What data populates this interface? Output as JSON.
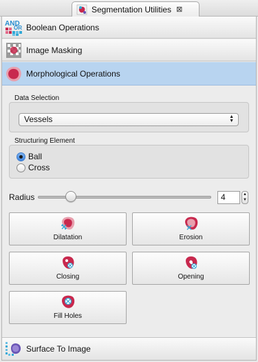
{
  "tab": {
    "title": "Segmentation Utilities",
    "close_icon": "close-icon",
    "icon": "segmentation-utilities-icon"
  },
  "sections": {
    "boolean": {
      "label": "Boolean Operations",
      "icon": "boolean-operations-icon",
      "icon_text": [
        "AND",
        "OR"
      ]
    },
    "masking": {
      "label": "Image Masking",
      "icon": "image-masking-icon"
    },
    "morphological": {
      "label": "Morphological Operations",
      "icon": "morphological-operations-icon",
      "expanded": true
    },
    "surface": {
      "label": "Surface To Image",
      "icon": "surface-to-image-icon"
    }
  },
  "data_selection": {
    "label": "Data Selection",
    "selected": "Vessels"
  },
  "structuring_element": {
    "label": "Structuring Element",
    "options": [
      {
        "label": "Ball",
        "checked": true
      },
      {
        "label": "Cross",
        "checked": false
      }
    ]
  },
  "radius": {
    "label": "Radius",
    "value": "4",
    "slider_fraction": 0.17
  },
  "operations": {
    "dilatation": {
      "label": "Dilatation",
      "icon": "dilatation-icon"
    },
    "erosion": {
      "label": "Erosion",
      "icon": "erosion-icon"
    },
    "closing": {
      "label": "Closing",
      "icon": "closing-icon"
    },
    "opening": {
      "label": "Opening",
      "icon": "opening-icon"
    },
    "fill_holes": {
      "label": "Fill Holes",
      "icon": "fill-holes-icon"
    }
  },
  "colors": {
    "selected_header": "#b8d4f0",
    "blob": "#c8294e",
    "blob_light": "#e8a0ae",
    "accent_cyan": "#33a9d6"
  }
}
